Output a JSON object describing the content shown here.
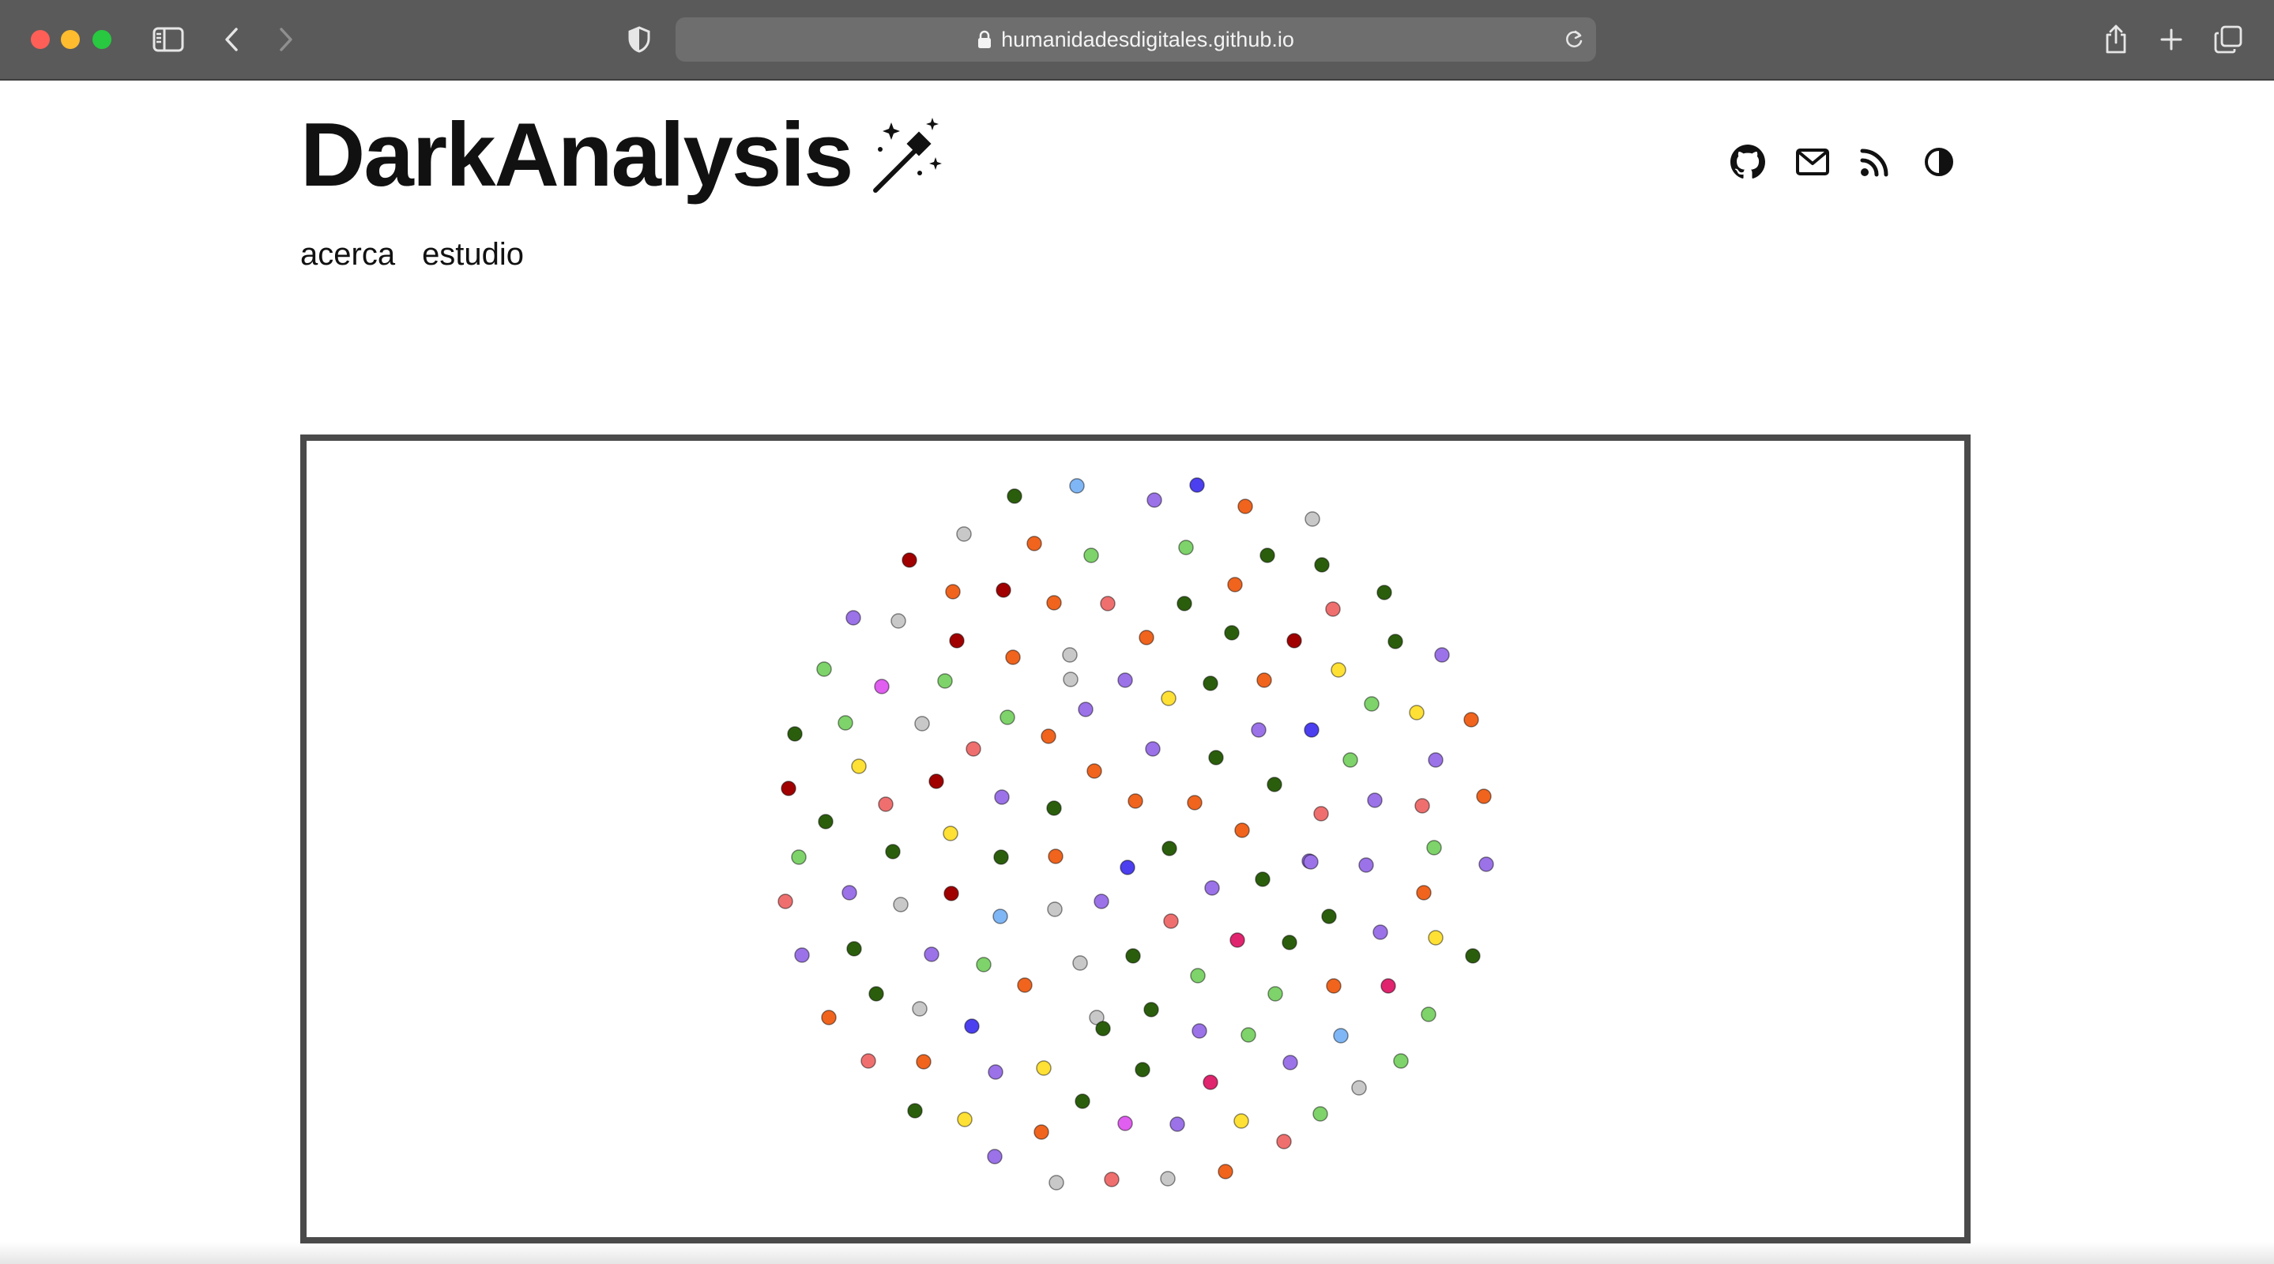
{
  "browser": {
    "url": "humanidadesdigitales.github.io",
    "icons": [
      "sidebar-icon",
      "back-icon",
      "forward-icon",
      "shield-icon",
      "lock-icon",
      "reload-icon",
      "share-icon",
      "new-tab-icon",
      "tabs-overview-icon"
    ]
  },
  "site": {
    "title": "DarkAnalysis",
    "title_icon": "magic-wand-icon",
    "nav": [
      {
        "label": "acerca"
      },
      {
        "label": "estudio"
      }
    ],
    "social_icons": [
      "github-icon",
      "mail-icon",
      "rss-icon",
      "contrast-icon"
    ]
  },
  "graph": {
    "description_colors": {
      "dark_green": "#2b5e0c",
      "light_green": "#7ed36a",
      "purple": "#9b72e8",
      "orange": "#f0641e",
      "grey": "#c8c8c8",
      "dark_red": "#a00000",
      "salmon": "#ef6f6f",
      "yellow": "#ffe135",
      "blue": "#4b3ff0",
      "light_blue": "#7fb6f5",
      "magenta": "#e05ef0",
      "pink": "#e0246e"
    }
  }
}
